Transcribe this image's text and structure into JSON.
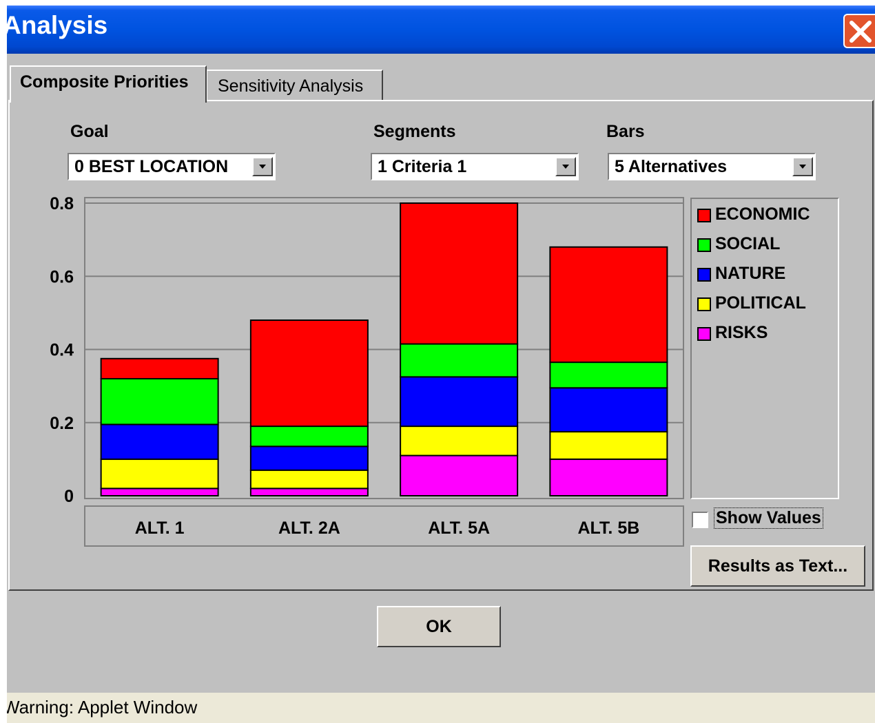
{
  "window": {
    "title": "Analysis",
    "status_text": "Warning: Applet Window"
  },
  "tabs": [
    {
      "label": "Composite Priorities",
      "active": true
    },
    {
      "label": "Sensitivity Analysis",
      "active": false
    }
  ],
  "controls": {
    "goal": {
      "label": "Goal",
      "value": "0 BEST LOCATION"
    },
    "segments": {
      "label": "Segments",
      "value": "1 Criteria 1"
    },
    "bars": {
      "label": "Bars",
      "value": "5 Alternatives"
    },
    "show_values": {
      "label": "Show Values",
      "checked": false
    },
    "results_button": "Results as Text...",
    "ok_button": "OK"
  },
  "chart_data": {
    "type": "bar",
    "stacked": true,
    "categories": [
      "ALT. 1",
      "ALT. 2A",
      "ALT. 5A",
      "ALT. 5B"
    ],
    "series": [
      {
        "name": "RISKS",
        "color": "#ff00ff",
        "values": [
          0.02,
          0.02,
          0.11,
          0.1
        ]
      },
      {
        "name": "POLITICAL",
        "color": "#ffff00",
        "values": [
          0.08,
          0.05,
          0.08,
          0.075
        ]
      },
      {
        "name": "NATURE",
        "color": "#0000ff",
        "values": [
          0.095,
          0.065,
          0.135,
          0.12
        ]
      },
      {
        "name": "SOCIAL",
        "color": "#00ff00",
        "values": [
          0.125,
          0.055,
          0.09,
          0.07
        ]
      },
      {
        "name": "ECONOMIC",
        "color": "#ff0000",
        "values": [
          0.055,
          0.29,
          0.385,
          0.315
        ]
      }
    ],
    "legend_order": [
      "ECONOMIC",
      "SOCIAL",
      "NATURE",
      "POLITICAL",
      "RISKS"
    ],
    "y_ticks": [
      "0",
      "0.2",
      "0.4",
      "0.6",
      "0.8"
    ],
    "ylim": [
      0,
      0.8
    ],
    "grid": true,
    "legend_position": "right"
  }
}
